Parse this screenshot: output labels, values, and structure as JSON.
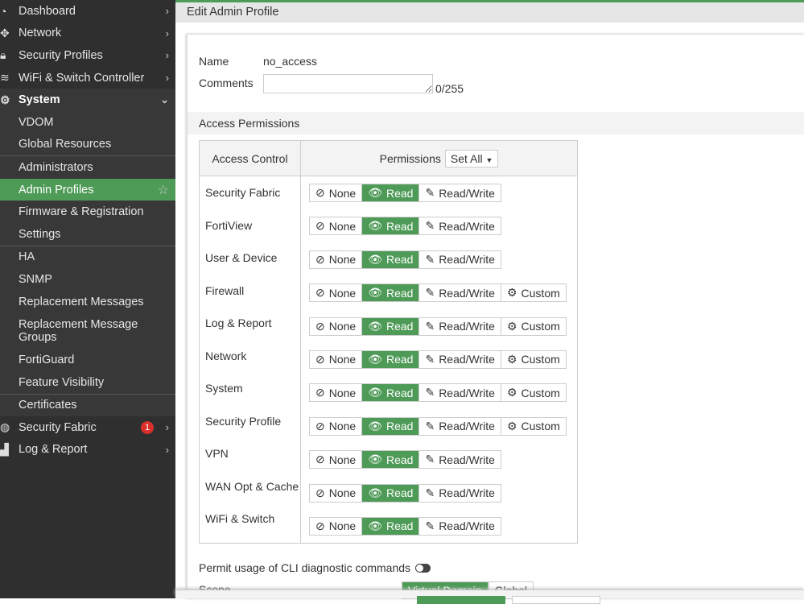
{
  "sidebar": {
    "items": [
      {
        "label": "Dashboard",
        "icon": "dashboard-icon"
      },
      {
        "label": "Network",
        "icon": "move-icon"
      },
      {
        "label": "Security Profiles",
        "icon": "lock-icon"
      },
      {
        "label": "WiFi & Switch Controller",
        "icon": "wifi-icon"
      },
      {
        "label": "System",
        "icon": "gear-icon"
      },
      {
        "label": "VDOM"
      },
      {
        "label": "Global Resources"
      },
      {
        "label": "Administrators"
      },
      {
        "label": "Admin Profiles"
      },
      {
        "label": "Firmware & Registration"
      },
      {
        "label": "Settings"
      },
      {
        "label": "HA"
      },
      {
        "label": "SNMP"
      },
      {
        "label": "Replacement Messages"
      },
      {
        "label": "Replacement Message Groups"
      },
      {
        "label": "FortiGuard"
      },
      {
        "label": "Feature Visibility"
      },
      {
        "label": "Certificates"
      },
      {
        "label": "Security Fabric",
        "icon": "security-fabric-icon",
        "badge": "1"
      },
      {
        "label": "Log & Report",
        "icon": "chart-icon"
      }
    ]
  },
  "header": {
    "title": "Edit Admin Profile"
  },
  "form": {
    "name_label": "Name",
    "name_value": "no_access",
    "comments_label": "Comments",
    "comments_value": "",
    "comments_count": "0/255"
  },
  "permissions": {
    "section_title": "Access Permissions",
    "col_access": "Access Control",
    "col_permissions": "Permissions",
    "set_all": "Set All",
    "options": {
      "none": "None",
      "read": "Read",
      "readwrite": "Read/Write",
      "custom": "Custom"
    },
    "rows": [
      {
        "label": "Security Fabric",
        "selected": "Read",
        "custom": false
      },
      {
        "label": "FortiView",
        "selected": "Read",
        "custom": false
      },
      {
        "label": "User & Device",
        "selected": "Read",
        "custom": false
      },
      {
        "label": "Firewall",
        "selected": "Read",
        "custom": true
      },
      {
        "label": "Log & Report",
        "selected": "Read",
        "custom": true
      },
      {
        "label": "Network",
        "selected": "Read",
        "custom": true
      },
      {
        "label": "System",
        "selected": "Read",
        "custom": true
      },
      {
        "label": "Security Profile",
        "selected": "Read",
        "custom": true
      },
      {
        "label": "VPN",
        "selected": "Read",
        "custom": false
      },
      {
        "label": "WAN Opt & Cache",
        "selected": "Read",
        "custom": false
      },
      {
        "label": "WiFi & Switch",
        "selected": "Read",
        "custom": false
      }
    ]
  },
  "cli": {
    "label": "Permit usage of CLI diagnostic commands",
    "enabled": false
  },
  "scope": {
    "label": "Scope",
    "options": [
      "Virtual Domain",
      "Global"
    ],
    "selected": "Virtual Domain"
  },
  "colors": {
    "accent": "#4e9a57",
    "sidebar": "#2f2f2f",
    "badge": "#d9302c"
  }
}
